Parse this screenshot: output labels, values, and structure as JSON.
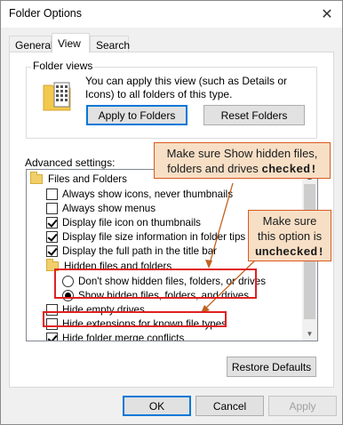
{
  "window": {
    "title": "Folder Options",
    "close_glyph": "✕"
  },
  "tabs": [
    {
      "label": "General"
    },
    {
      "label": "View",
      "active": true
    },
    {
      "label": "Search"
    }
  ],
  "folder_views": {
    "legend": "Folder views",
    "icon": "folder-grid-icon",
    "description": "You can apply this view (such as Details or Icons) to all folders of this type.",
    "apply_button": "Apply to Folders",
    "reset_button": "Reset Folders"
  },
  "advanced": {
    "label": "Advanced settings:",
    "items": [
      {
        "type": "folder",
        "label": "Files and Folders",
        "indent": 0
      },
      {
        "type": "checkbox",
        "label": "Always show icons, never thumbnails",
        "checked": false,
        "indent": 1
      },
      {
        "type": "checkbox",
        "label": "Always show menus",
        "checked": false,
        "indent": 1
      },
      {
        "type": "checkbox",
        "label": "Display file icon on thumbnails",
        "checked": true,
        "indent": 1
      },
      {
        "type": "checkbox",
        "label": "Display file size information in folder tips",
        "checked": true,
        "indent": 1
      },
      {
        "type": "checkbox",
        "label": "Display the full path in the title bar",
        "checked": true,
        "indent": 1
      },
      {
        "type": "folder",
        "label": "Hidden files and folders",
        "indent": 1
      },
      {
        "type": "radio",
        "label": "Don't show hidden files, folders, or drives",
        "selected": false,
        "indent": 2
      },
      {
        "type": "radio",
        "label": "Show hidden files, folders, and drives",
        "selected": true,
        "indent": 2
      },
      {
        "type": "checkbox",
        "label": "Hide empty drives",
        "checked": false,
        "indent": 1
      },
      {
        "type": "checkbox",
        "label": "Hide extensions for known file types",
        "checked": false,
        "indent": 1
      },
      {
        "type": "checkbox",
        "label": "Hide folder merge conflicts",
        "checked": true,
        "indent": 1
      }
    ],
    "restore_button": "Restore Defaults"
  },
  "callouts": {
    "first_line1": "Make sure Show hidden files,",
    "first_line2": "folders and drives",
    "first_bold": "checked!",
    "second_line1": "Make sure",
    "second_line2": "this option is",
    "second_bold": "unchecked!"
  },
  "footer": {
    "ok": "OK",
    "cancel": "Cancel",
    "apply": "Apply"
  },
  "colors": {
    "highlight": "#e02020",
    "callout_bg": "#f7dfc6",
    "callout_border": "#d85a20",
    "accent": "#0078d7"
  }
}
